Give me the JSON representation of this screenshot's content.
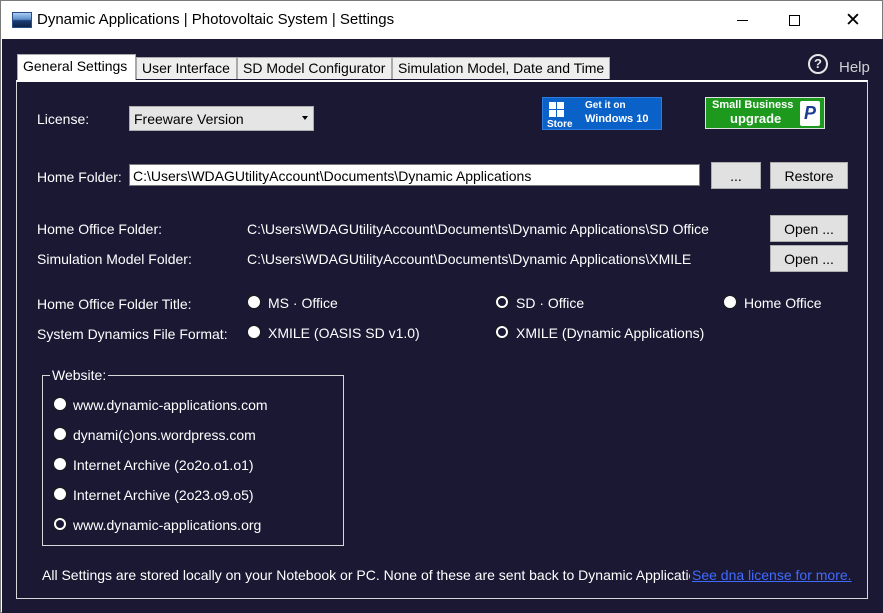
{
  "window": {
    "title": "Dynamic Applications | Photovoltaic System | Settings",
    "icon": "app-landscape-icon"
  },
  "tabs": [
    {
      "label": "General Settings",
      "active": true
    },
    {
      "label": "User Interface",
      "active": false
    },
    {
      "label": "SD Model Configurator",
      "active": false
    },
    {
      "label": "Simulation Model, Date and Time",
      "active": false
    }
  ],
  "help": {
    "icon": "help-question-icon",
    "label": "Help"
  },
  "license": {
    "label": "License:",
    "selected": "Freeware Version"
  },
  "store_badge": {
    "brand": "Store",
    "line1": "Get it on",
    "line2": "Windows 10",
    "color": "#0a61c8"
  },
  "paypal_badge": {
    "line1": "Small Business",
    "line2": "upgrade",
    "logo": "P",
    "color": "#1d9a1d"
  },
  "home_folder": {
    "label": "Home Folder:",
    "value": "C:\\Users\\WDAGUtilityAccount\\Documents\\Dynamic Applications",
    "browse_label": "...",
    "restore_label": "Restore"
  },
  "home_office_folder": {
    "label": "Home Office Folder:",
    "path": "C:\\Users\\WDAGUtilityAccount\\Documents\\Dynamic Applications\\SD Office",
    "open_label": "Open ..."
  },
  "simulation_model_folder": {
    "label": "Simulation Model Folder:",
    "path": "C:\\Users\\WDAGUtilityAccount\\Documents\\Dynamic Applications\\XMILE",
    "open_label": "Open ..."
  },
  "office_title": {
    "label": "Home Office Folder Title:",
    "options": [
      {
        "label": "MS · Office",
        "selected": false
      },
      {
        "label": "SD · Office",
        "selected": true
      },
      {
        "label": "Home Office",
        "selected": false
      }
    ]
  },
  "file_format": {
    "label": "System Dynamics File Format:",
    "options": [
      {
        "label": "XMILE  (OASIS SD v1.0)",
        "selected": false
      },
      {
        "label": "XMILE  (Dynamic Applications)",
        "selected": true
      }
    ]
  },
  "website": {
    "label": "Website:",
    "options": [
      {
        "label": "www.dynamic-applications.com",
        "selected": false
      },
      {
        "label": "dynami(c)ons.wordpress.com",
        "selected": false
      },
      {
        "label": "Internet Archive (2o2o.o1.o1)",
        "selected": false
      },
      {
        "label": "Internet Archive (2o23.o9.o5)",
        "selected": false
      },
      {
        "label": "www.dynamic-applications.org",
        "selected": true
      }
    ]
  },
  "footer": {
    "text": "All Settings are stored locally on your Notebook or PC. None of these are sent back to Dynamic Applications.",
    "link": "See dna license for more."
  },
  "colors": {
    "background": "#1a1833",
    "link": "#3f6cff"
  }
}
